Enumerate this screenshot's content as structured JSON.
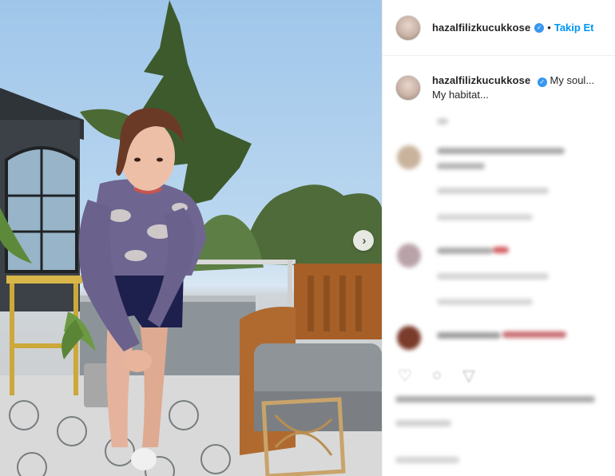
{
  "post": {
    "author": "hazalfilizkucukkose",
    "verified": true,
    "follow_label": "Takip Et",
    "separator": "•",
    "caption_text": "My soul...",
    "caption_line2": "My habitat..."
  },
  "icons": {
    "carousel_next": "chevron-right-icon",
    "verified": "verified-badge-icon",
    "like": "heart-icon",
    "comment": "comment-icon",
    "share": "share-icon"
  },
  "colors": {
    "accent": "#0095f6",
    "verified": "#3897f0",
    "text": "#262626"
  }
}
